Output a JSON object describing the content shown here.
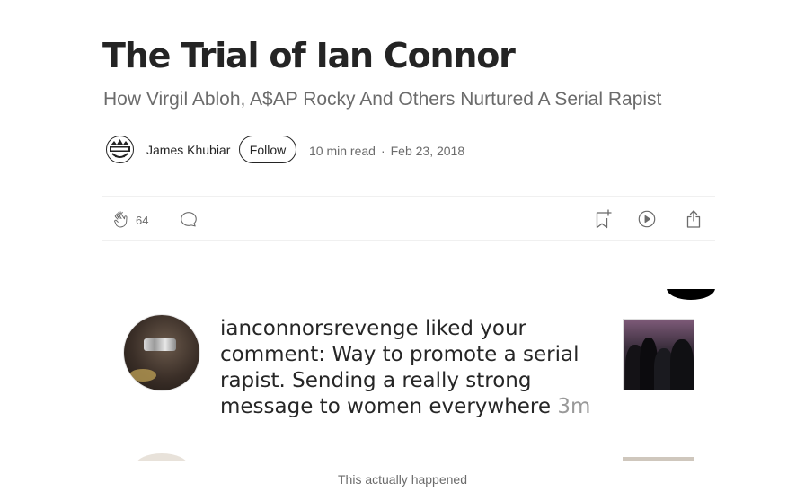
{
  "article": {
    "title": "The Trial of Ian Connor",
    "subtitle": "How Virgil Abloh, A$AP Rocky And Others Nurtured A Serial Rapist"
  },
  "author": {
    "name": "James Khubiar",
    "follow_label": "Follow",
    "read_time": "10 min read",
    "separator": "·",
    "date": "Feb 23, 2018"
  },
  "actions": {
    "clap_icon": "clap-icon",
    "clap_count": "64",
    "comment_icon": "comment-icon",
    "bookmark_icon": "bookmark-add-icon",
    "listen_icon": "play-icon",
    "share_icon": "share-icon"
  },
  "embedded_image": {
    "username": "ianconnorsrevenge",
    "message": " liked your comment: Way to promote a serial rapist. Sending a really strong message to women everywhere ",
    "time": "3m",
    "caption": "This actually happened"
  },
  "colors": {
    "text_primary": "#242424",
    "text_secondary": "#6b6b6b",
    "divider": "#f0f0f0",
    "instagram_time": "#999999"
  }
}
